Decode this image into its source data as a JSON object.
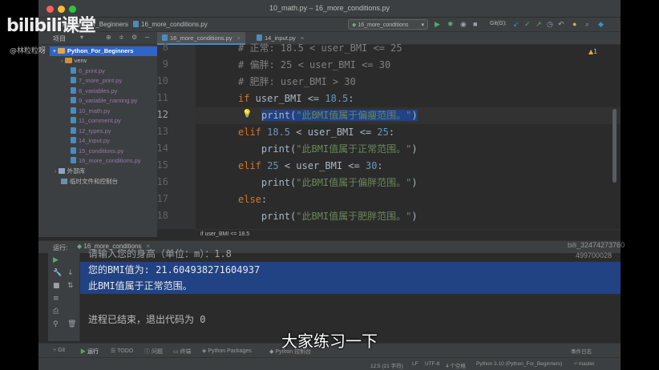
{
  "overlay": {
    "logo": "bilibili课堂",
    "uploader": "@林粒粒呀",
    "watermark_line1": "bili_32474273760",
    "watermark_line2": "499700028",
    "subtitle": "大家练习一下"
  },
  "window": {
    "title": "10_math.py – 16_more_conditions.py"
  },
  "navbar": {
    "project": "Python_For_Beginners",
    "file": "16_more_conditions.py",
    "run_config": "16_more_conditions",
    "git_label": "Git(G):"
  },
  "project_panel": {
    "header": "项目",
    "strip_project": "项目",
    "strip_structure": "结构",
    "strip_bookmarks": "书签",
    "root": "Python_For_Beginners",
    "venv": "venv",
    "files": [
      "6_print.py",
      "7_more_print.py",
      "8_variables.py",
      "9_variable_naming.py",
      "10_math.py",
      "11_comment.py",
      "12_types.py",
      "14_input.py",
      "15_conditions.py",
      "16_more_conditions.py"
    ],
    "external_libs": "外部库",
    "scratches": "临时文件和控制台"
  },
  "editor": {
    "tabs": [
      "16_more_conditions.py",
      "14_input.py"
    ],
    "line_numbers": [
      "8",
      "9",
      "10",
      "11",
      "12",
      "13",
      "14",
      "15",
      "16",
      "17",
      "18"
    ],
    "current_line": 12,
    "lines": {
      "l8_comment": "# 正常: 18.5 < user_BMI <= 25",
      "l9_comment": "# 偏胖: 25 < user_BMI <= 30",
      "l10_comment": "# 肥胖: user_BMI > 30",
      "l11_kw": "if",
      "l11_var": " user_BMI <= ",
      "l11_num": "18.5",
      "l11_colon": ":",
      "l12_fn": "print(",
      "l12_str": "\"此BMI值属于偏瘦范围。\"",
      "l12_close": ")",
      "l13_kw": "elif",
      "l13_num1": " 18.5",
      "l13_mid": " < user_BMI <= ",
      "l13_num2": "25",
      "l13_colon": ":",
      "l14_indent": "    print(",
      "l14_str": "\"此BMI值属于正常范围。\"",
      "l14_close": ")",
      "l15_kw": "elif",
      "l15_num1": " 25",
      "l15_mid": " < user_BMI <= ",
      "l15_num2": "30",
      "l15_colon": ":",
      "l16_indent": "    print(",
      "l16_str": "\"此BMI值属于偏胖范围。\"",
      "l16_close": ")",
      "l17_kw": "else",
      "l17_colon": ":",
      "l18_indent": "    print(",
      "l18_str": "\"此BMI值属于肥胖范围。\"",
      "l18_close": ")"
    },
    "warning_count": "1",
    "breadcrumb": "if user_BMI <= 18.5"
  },
  "run_panel": {
    "label": "运行:",
    "tab": "16_more_conditions",
    "lines": [
      "请输入您的身高（单位：m）：1.8",
      "您的BMI值为: 21.604938271604937",
      "此BMI值属于正常范围。",
      "",
      "进程已结束，退出代码为 0"
    ]
  },
  "tool_tabs": [
    "Git",
    "运行",
    "TODO",
    "问题",
    "终端",
    "Python Packages",
    "Python 控制台"
  ],
  "status_bar": {
    "position": "12:5 (21 字符)",
    "line_sep": "LF",
    "encoding": "UTF-8",
    "indent": "4 个空格",
    "interpreter": "Python 3.10 (Python_For_Beginners)",
    "branch": "master",
    "event_log": "事件日志"
  }
}
